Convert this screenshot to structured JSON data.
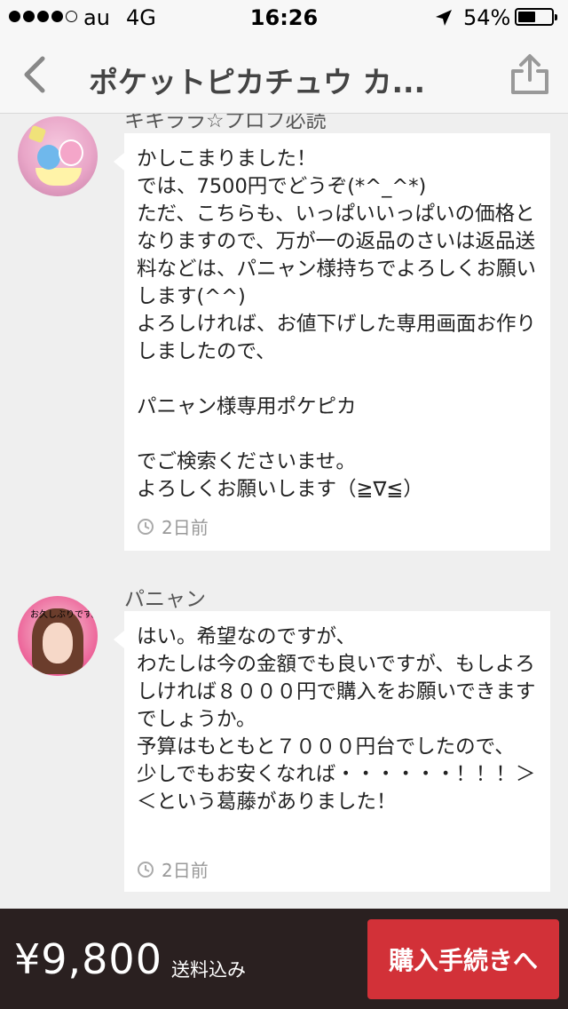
{
  "status_bar": {
    "carrier": "au",
    "network": "4G",
    "time": "16:26",
    "battery": "54%",
    "battery_level": 0.54,
    "signal_bars_filled": 4,
    "signal_bars_total": 5,
    "icons": [
      "location-arrow-icon",
      "battery-icon"
    ]
  },
  "nav": {
    "title": "ポケットピカチュウ カ...",
    "back_icon": "chevron-left-icon",
    "share_icon": "share-icon"
  },
  "comments": [
    {
      "author": "キキララ☆プロフ必読",
      "body": "かしこまりました！\nでは、7500円でどうぞ(*^_^*)\nただ、こちらも、いっぱいいっぱいの価格となりますので、万が一の返品のさいは返品送料などは、パニャン様持ちでよろしくお願いします(^^)\nよろしければ、お値下げした専用画面お作りしましたので、\n\nパニャン様専用ポケピカ\n\nでご検索くださいませ。\nよろしくお願いします（≧∇≦）",
      "time": "2日前"
    },
    {
      "author": "パニャン",
      "avatar_text": "お久しぶりです。",
      "body": "はい。希望なのですが、\nわたしは今の金額でも良いですが、もしよろしければ８０００円で購入をお願いできますでしょうか。\n予算はもともと７０００円台でしたので、　少しでもお安くなれば・・・・・・！！！＞＜という葛藤がありました！",
      "time": "2日前"
    }
  ],
  "bottom_bar": {
    "price": "¥9,800",
    "tax_note": "送料込み",
    "buy_button": "購入手続きへ"
  },
  "colors": {
    "accent": "#d23138",
    "bottom_bar": "#2a2020",
    "background": "#efefef"
  }
}
